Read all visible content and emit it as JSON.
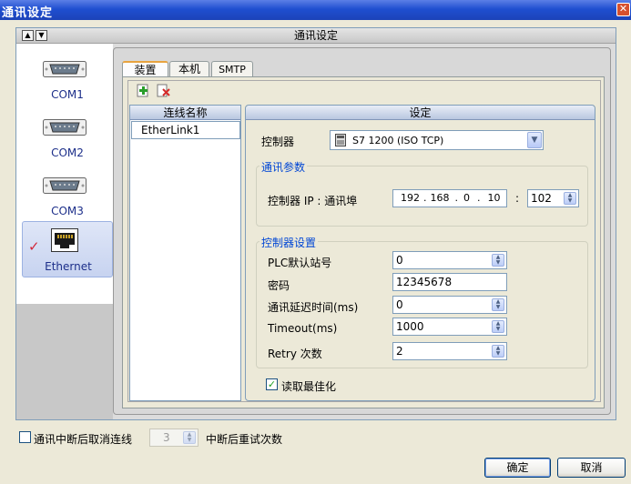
{
  "window": {
    "title": "通讯设定",
    "close_icon": "close-icon"
  },
  "header": {
    "title": "通讯设定"
  },
  "nav": {
    "items": [
      {
        "label": "COM1",
        "icon": "serial-port-icon"
      },
      {
        "label": "COM2",
        "icon": "serial-port-icon"
      },
      {
        "label": "COM3",
        "icon": "serial-port-icon"
      },
      {
        "label": "Ethernet",
        "icon": "ethernet-port-icon",
        "selected": true
      }
    ]
  },
  "tabs": [
    {
      "label": "装置",
      "active": true
    },
    {
      "label": "本机"
    },
    {
      "label": "SMTP"
    }
  ],
  "toolbar": {
    "add_icon": "add-device-icon",
    "delete_icon": "delete-device-icon"
  },
  "device_list": {
    "header": "连线名称",
    "items": [
      "EtherLink1"
    ]
  },
  "settings": {
    "header": "设定",
    "controller_label": "控制器",
    "controller_value": "S7 1200 (ISO TCP)",
    "comm_group": {
      "title": "通讯参数",
      "ip_label": "控制器 IP : 通讯埠",
      "ip": [
        "192",
        "168",
        "0",
        "10"
      ],
      "port": "102"
    },
    "ctrl_group": {
      "title": "控制器设置",
      "fields": [
        {
          "label": "PLC默认站号",
          "value": "0"
        },
        {
          "label": "密码",
          "value": "12345678"
        },
        {
          "label": "通讯延迟时间(ms)",
          "value": "0"
        },
        {
          "label": "Timeout(ms)",
          "value": "1000"
        },
        {
          "label": "Retry 次数",
          "value": "2"
        }
      ]
    },
    "read_opt_label": "读取最佳化",
    "read_opt_checked": true
  },
  "footer": {
    "cancel_conn_label": "通讯中断后取消连线",
    "cancel_conn_checked": false,
    "retry_value": "3",
    "retry_label": "中断后重试次数",
    "ok_label": "确定",
    "cancel_label": "取消"
  },
  "colors": {
    "titlebar": "#1f4fd0",
    "group_title": "#0046d5",
    "nav_selected": "#c7d3f0"
  }
}
